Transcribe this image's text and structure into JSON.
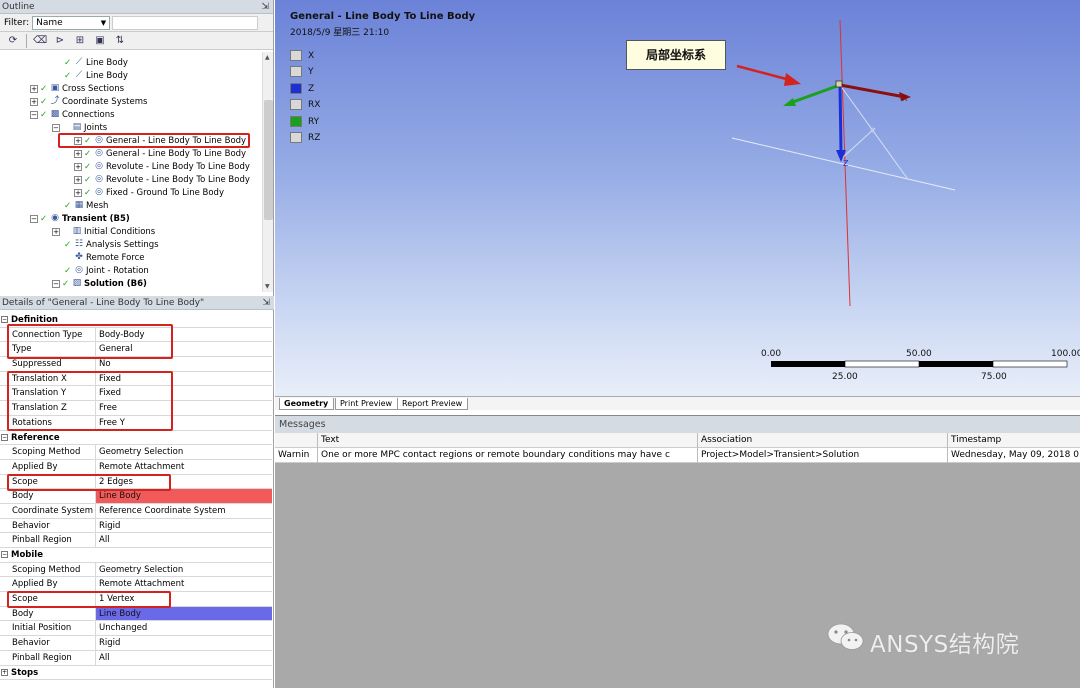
{
  "outline": {
    "title": "Outline",
    "pin": "⇲",
    "filter_label": "Filter:",
    "filter_value": "Name",
    "tree": [
      {
        "label": "Line Body",
        "indent": 52,
        "icon": "line-body-icon",
        "glyph": "⟋",
        "check": true,
        "exp": ""
      },
      {
        "label": "Line Body",
        "indent": 52,
        "icon": "line-body-icon",
        "glyph": "⟋",
        "check": true,
        "exp": ""
      },
      {
        "label": "Cross Sections",
        "indent": 30,
        "icon": "cross-sections-icon",
        "glyph": "▣",
        "check": true,
        "exp": "+"
      },
      {
        "label": "Coordinate Systems",
        "indent": 30,
        "icon": "coordinate-systems-icon",
        "glyph": "⤴",
        "check": true,
        "exp": "+"
      },
      {
        "label": "Connections",
        "indent": 30,
        "icon": "connections-icon",
        "glyph": "▩",
        "check": true,
        "exp": "-"
      },
      {
        "label": "Joints",
        "indent": 52,
        "icon": "joints-folder-icon",
        "glyph": "▤",
        "check": false,
        "exp": "-"
      },
      {
        "label": "General - Line Body To Line Body",
        "indent": 74,
        "icon": "joint-icon",
        "glyph": "◎",
        "check": true,
        "exp": "+"
      },
      {
        "label": "General - Line Body To Line Body",
        "indent": 74,
        "icon": "joint-icon",
        "glyph": "◎",
        "check": true,
        "exp": "+"
      },
      {
        "label": "Revolute - Line Body To Line Body",
        "indent": 74,
        "icon": "joint-icon",
        "glyph": "◎",
        "check": true,
        "exp": "+"
      },
      {
        "label": "Revolute - Line Body To Line Body",
        "indent": 74,
        "icon": "joint-icon",
        "glyph": "◎",
        "check": true,
        "exp": "+"
      },
      {
        "label": "Fixed - Ground To Line Body",
        "indent": 74,
        "icon": "joint-icon",
        "glyph": "◎",
        "check": true,
        "exp": "+"
      },
      {
        "label": "Mesh",
        "indent": 52,
        "icon": "mesh-icon",
        "glyph": "▦",
        "check": true,
        "exp": ""
      },
      {
        "label": "Transient (B5)",
        "indent": 30,
        "icon": "transient-icon",
        "glyph": "◉",
        "check": true,
        "exp": "-",
        "bold": true
      },
      {
        "label": "Initial Conditions",
        "indent": 52,
        "icon": "initial-conditions-icon",
        "glyph": "▥",
        "check": false,
        "exp": "+"
      },
      {
        "label": "Analysis Settings",
        "indent": 52,
        "icon": "analysis-settings-icon",
        "glyph": "☷",
        "check": true,
        "exp": ""
      },
      {
        "label": "Remote Force",
        "indent": 52,
        "icon": "remote-force-icon",
        "glyph": "✤",
        "check": false,
        "exp": ""
      },
      {
        "label": "Joint - Rotation",
        "indent": 52,
        "icon": "joint-rotation-icon",
        "glyph": "◎",
        "check": true,
        "exp": ""
      },
      {
        "label": "Solution (B6)",
        "indent": 52,
        "icon": "solution-icon",
        "glyph": "▨",
        "check": true,
        "exp": "-",
        "bold": true
      }
    ]
  },
  "details": {
    "title": "Details of \"General - Line Body To Line Body\"",
    "rows": [
      {
        "section": true,
        "label": "Definition"
      },
      {
        "k": "Connection Type",
        "v": "Body-Body"
      },
      {
        "k": "Type",
        "v": "General"
      },
      {
        "k": "Suppressed",
        "v": "No"
      },
      {
        "k": "Translation X",
        "v": "Fixed"
      },
      {
        "k": "Translation Y",
        "v": "Fixed"
      },
      {
        "k": "Translation Z",
        "v": "Free"
      },
      {
        "k": "Rotations",
        "v": "Free Y"
      },
      {
        "section": true,
        "label": "Reference"
      },
      {
        "k": "Scoping Method",
        "v": "Geometry Selection"
      },
      {
        "k": "Applied By",
        "v": "Remote Attachment"
      },
      {
        "k": "Scope",
        "v": "2 Edges"
      },
      {
        "k": "Body",
        "v": "Line Body",
        "hl": "red"
      },
      {
        "k": "Coordinate System",
        "v": "Reference Coordinate System"
      },
      {
        "k": "Behavior",
        "v": "Rigid"
      },
      {
        "k": "Pinball Region",
        "v": "All"
      },
      {
        "section": true,
        "label": "Mobile"
      },
      {
        "k": "Scoping Method",
        "v": "Geometry Selection"
      },
      {
        "k": "Applied By",
        "v": "Remote Attachment"
      },
      {
        "k": "Scope",
        "v": "1 Vertex"
      },
      {
        "k": "Body",
        "v": "Line Body",
        "hl": "blue"
      },
      {
        "k": "Initial Position",
        "v": "Unchanged"
      },
      {
        "k": "Behavior",
        "v": "Rigid"
      },
      {
        "k": "Pinball Region",
        "v": "All"
      },
      {
        "section": true,
        "label": "Stops",
        "collapsed": true
      }
    ]
  },
  "viewport": {
    "title": "General - Line Body To Line Body",
    "date": "2018/5/9 星期三 21:10",
    "annotation": "局部坐标系",
    "legend": [
      {
        "label": "X",
        "color": "#d8d8d8"
      },
      {
        "label": "Y",
        "color": "#d8d8d8"
      },
      {
        "label": "Z",
        "color": "#1b2fd8"
      },
      {
        "label": "RX",
        "color": "#d8d8d8"
      },
      {
        "label": "RY",
        "color": "#19a11b"
      },
      {
        "label": "RZ",
        "color": "#d8d8d8"
      }
    ],
    "axis_label_x": "X",
    "axis_label_z": "Z",
    "scale": {
      "top": [
        "0.00",
        "50.00",
        "100.00"
      ],
      "bottom": [
        "25.00",
        "75.00"
      ]
    }
  },
  "tabs": [
    "Geometry",
    "Print Preview",
    "Report Preview"
  ],
  "messages": {
    "title": "Messages",
    "headers": [
      "Text",
      "Association",
      "Timestamp"
    ],
    "row": {
      "type": "Warnin",
      "text": "One or more MPC contact regions or remote boundary conditions may have c",
      "association": "Project>Model>Transient>Solution",
      "timestamp": "Wednesday, May 09, 2018 0"
    }
  },
  "watermark": "ANSYS结构院",
  "watermark_icon": "wechat-icon",
  "colors": {
    "highlight_box": "#d3231f",
    "reference_body": "#f05a5a",
    "mobile_body": "#6a6ae8"
  }
}
